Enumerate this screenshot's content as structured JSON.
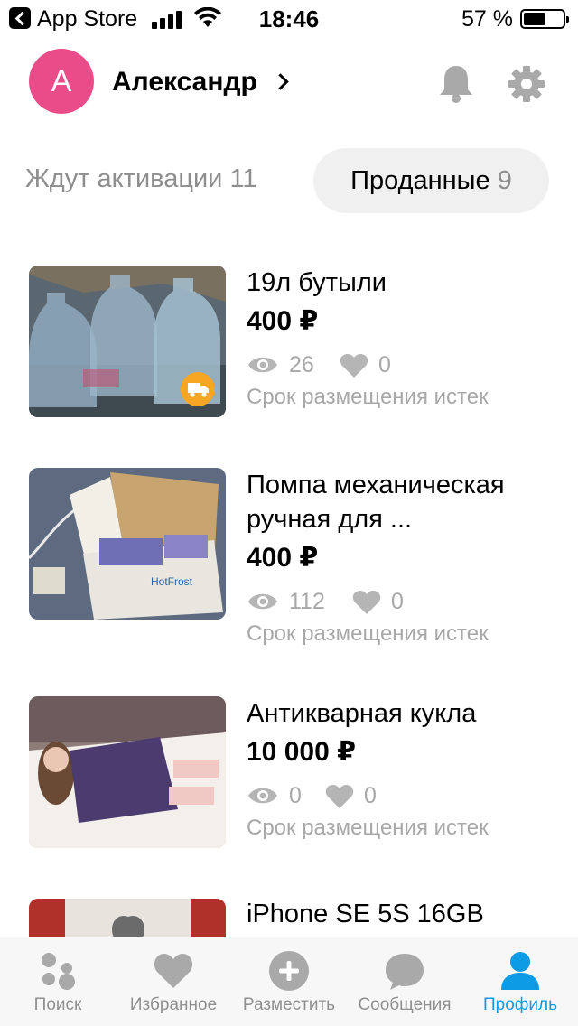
{
  "status_bar": {
    "back_label": "App Store",
    "time": "18:46",
    "battery": "57 %",
    "battery_level": 0.57
  },
  "header": {
    "avatar_letter": "А",
    "user_name": "Александр"
  },
  "tabs": {
    "waiting_label": "Ждут активации",
    "waiting_count": "11",
    "sold_label": "Проданные",
    "sold_count": "9"
  },
  "items": [
    {
      "title": "19л бутыли",
      "price": "400 ₽",
      "views": "26",
      "favorites": "0",
      "status": "Срок размещения истек",
      "delivery": true
    },
    {
      "title": "Помпа механическая ручная для ...",
      "price": "400 ₽",
      "views": "112",
      "favorites": "0",
      "status": "Срок размещения истек",
      "delivery": false
    },
    {
      "title": "Антикварная кукла",
      "price": "10 000 ₽",
      "views": "0",
      "favorites": "0",
      "status": "Срок размещения истек",
      "delivery": false
    },
    {
      "title": "iPhone SE 5S 16GB"
    }
  ],
  "tabbar": {
    "search": "Поиск",
    "favorites": "Избранное",
    "post": "Разместить",
    "messages": "Сообщения",
    "profile": "Профиль"
  },
  "colors": {
    "avatar": "#ea4c89",
    "accent": "#0d9be6",
    "delivery_badge": "#f6a623"
  }
}
